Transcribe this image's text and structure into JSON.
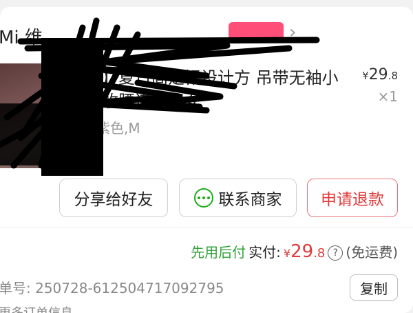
{
  "store": {
    "name": "Mi 维",
    "badge": "",
    "chevron": "›"
  },
  "product": {
    "title": "纯棉】夏日高定裙设计方 吊带无袖小针织收腰连衣裙女",
    "spec": "葡萄紫色,M",
    "price_currency": "¥",
    "price_int": "29",
    "price_dec": ".8",
    "qty": "×1"
  },
  "actions": {
    "share_label": "分享给好友",
    "contact_label": "联系商家",
    "refund_label": "申请退款"
  },
  "payment": {
    "tag": "先用后付",
    "label": "实付:",
    "currency": "¥",
    "amount_int": "29",
    "amount_dec": ".8",
    "help_symbol": "?",
    "note": "(免运费)"
  },
  "order": {
    "number_text": "单号: 250728-612504717092795",
    "copy_label": "复制",
    "more_text": "更多订单信息 ⌄"
  },
  "colors": {
    "accent_red": "#e23a3a",
    "pay_green": "#32a23a",
    "badge_pink": "#ff4f79",
    "chat_green": "#1aad19"
  },
  "icons": {
    "chat": "chat-bubble-icon",
    "help": "question-circle-icon",
    "chevron": "chevron-right-icon"
  }
}
